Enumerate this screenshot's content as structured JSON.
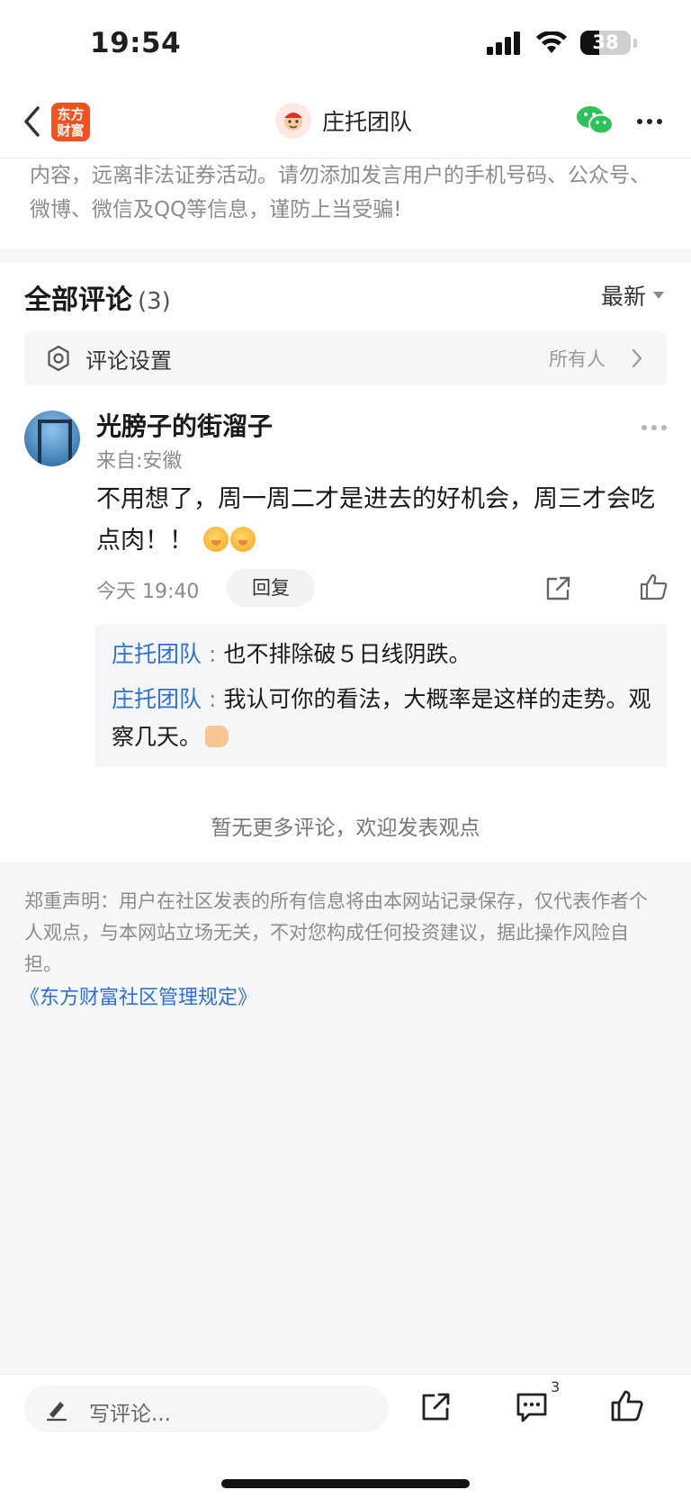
{
  "status_bar": {
    "time": "19:54",
    "battery": "38",
    "battery_level": 0.38
  },
  "nav": {
    "logo_text": "东方\n财富",
    "title": "庄托团队"
  },
  "notice": {
    "text": "内容，远离非法证券活动。请勿添加发言用户的手机号码、公众号、微博、微信及QQ等信息，谨防上当受骗!"
  },
  "comments": {
    "title": "全部评论",
    "count": "(3)",
    "sort_label": "最新",
    "settings": {
      "label": "评论设置",
      "value": "所有人"
    },
    "items": [
      {
        "user": "光膀子的街溜子",
        "from": "来自:安徽",
        "text": "不用想了，周一周二才是进去的好机会，周三才会吃点肉！！",
        "time": "今天 19:40",
        "reply_label": "回复",
        "replies": [
          {
            "user": "庄托团队",
            "sep": ":",
            "text": "也不排除破５日线阴跌。"
          },
          {
            "user": "庄托团队",
            "sep": ":",
            "text": "我认可你的看法，大概率是这样的走势。观察几天。"
          }
        ]
      }
    ],
    "no_more": "暂无更多评论，欢迎发表观点"
  },
  "disclaimer": {
    "text": "郑重声明：用户在社区发表的所有信息将由本网站记录保存，仅代表作者个人观点，与本网站立场无关，不对您构成任何投资建议，据此操作风险自担。",
    "link": "《东方财富社区管理规定》"
  },
  "bottom_bar": {
    "input_placeholder": "写评论...",
    "comment_count": "3"
  },
  "colors": {
    "link_blue": "#2f6fd6",
    "brand_orange": "#f4511e"
  }
}
